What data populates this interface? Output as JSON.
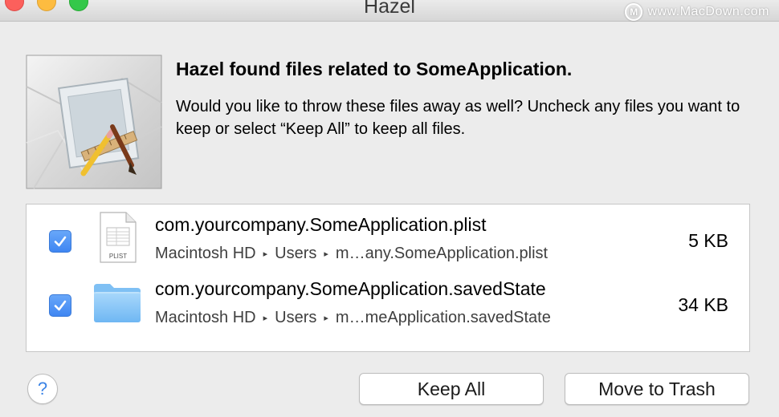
{
  "window": {
    "title": "Hazel",
    "watermark": "www.MacDown.com",
    "watermark_logo": "M"
  },
  "dialog": {
    "heading": "Hazel found files related to SomeApplication.",
    "message": "Would you like to throw these files away as well? Uncheck any files you want to keep or select “Keep All” to keep all files.",
    "app_icon": "hazel-crumpled-paper-icon"
  },
  "files": [
    {
      "checked": true,
      "icon": "plist-file-icon",
      "icon_label": "PLIST",
      "name": "com.yourcompany.SomeApplication.plist",
      "path": [
        "Macintosh HD",
        "Users",
        "m…any.SomeApplication.plist"
      ],
      "size": "5 KB"
    },
    {
      "checked": true,
      "icon": "folder-icon",
      "name": "com.yourcompany.SomeApplication.savedState",
      "path": [
        "Macintosh HD",
        "Users",
        "m…meApplication.savedState"
      ],
      "size": "34 KB"
    }
  ],
  "buttons": {
    "help": "?",
    "keep_all": "Keep All",
    "move_to_trash": "Move to Trash"
  },
  "colors": {
    "accent": "#3f86f2",
    "window_bg": "#ececec",
    "close": "#fc605c",
    "minimize": "#fdbc40",
    "zoom": "#34c84a"
  }
}
